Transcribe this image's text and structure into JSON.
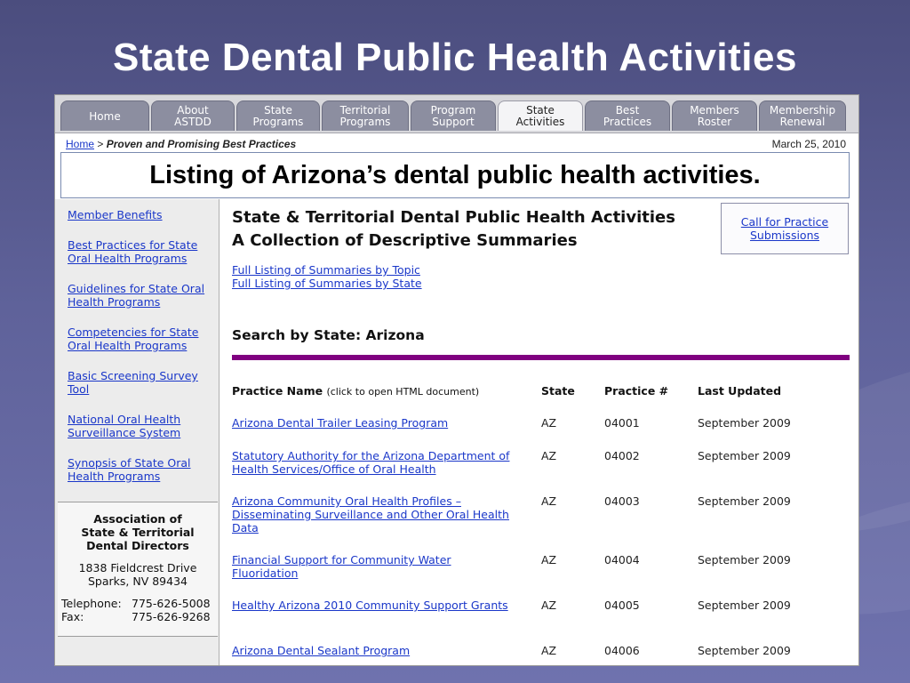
{
  "slide": {
    "title": "State Dental Public Health Activities"
  },
  "nav": {
    "tabs": [
      {
        "label": "Home",
        "active": false
      },
      {
        "label": "About\nASTDD",
        "active": false
      },
      {
        "label": "State\nPrograms",
        "active": false
      },
      {
        "label": "Territorial\nPrograms",
        "active": false
      },
      {
        "label": "Program\nSupport",
        "active": false
      },
      {
        "label": "State\nActivities",
        "active": true
      },
      {
        "label": "Best\nPractices",
        "active": false
      },
      {
        "label": "Members\nRoster",
        "active": false
      },
      {
        "label": "Membership\nRenewal",
        "active": false
      }
    ]
  },
  "breadcrumb": {
    "home": "Home",
    "separator": " > ",
    "current": "Proven and Promising Best Practices"
  },
  "date": "March 25, 2010",
  "callout": "Listing of Arizona’s dental public health activities.",
  "sidebar": {
    "links": [
      "Member Benefits",
      "Best Practices for State Oral Health Programs",
      "Guidelines for State Oral Health Programs",
      "Competencies for State Oral Health Programs",
      "Basic Screening Survey Tool",
      "National Oral Health Surveillance System",
      "Synopsis of State Oral Health Programs"
    ],
    "address": {
      "org_line1": "Association of",
      "org_line2": "State & Territorial",
      "org_line3": "Dental Directors",
      "street": "1838 Fieldcrest Drive",
      "city": "Sparks, NV 89434",
      "phone_label": "Telephone:",
      "phone": "775-626-5008",
      "fax_label": "Fax:",
      "fax": "775-626-9268"
    }
  },
  "main": {
    "heading_line1": "State & Territorial Dental Public Health Activities",
    "heading_line2": "A Collection of Descriptive Summaries",
    "call_link_line1": "Call for Practice",
    "call_link_line2": "Submissions",
    "listing_topic": "Full Listing of Summaries by Topic",
    "listing_state": "Full Listing of Summaries by State",
    "search_heading": "Search by State: Arizona",
    "table": {
      "headers": {
        "name": "Practice Name",
        "name_hint": "(click to open HTML document)",
        "state": "State",
        "number": "Practice #",
        "updated": "Last Updated"
      },
      "rows": [
        {
          "name": "Arizona Dental Trailer Leasing Program",
          "state": "AZ",
          "number": "04001",
          "updated": "September 2009"
        },
        {
          "name": "Statutory Authority for the Arizona Department of Health Services/Office of Oral Health",
          "state": "AZ",
          "number": "04002",
          "updated": "September 2009"
        },
        {
          "name": "Arizona Community Oral Health Profiles – Disseminating Surveillance and Other Oral Health Data",
          "state": "AZ",
          "number": "04003",
          "updated": "September 2009"
        },
        {
          "name": "Financial Support for Community Water Fluoridation",
          "state": "AZ",
          "number": "04004",
          "updated": "September 2009"
        },
        {
          "name": "Healthy Arizona 2010 Community Support Grants",
          "state": "AZ",
          "number": "04005",
          "updated": "September 2009"
        },
        {
          "name": "Arizona Dental Sealant Program",
          "state": "AZ",
          "number": "04006",
          "updated": "September 2009"
        }
      ]
    }
  }
}
